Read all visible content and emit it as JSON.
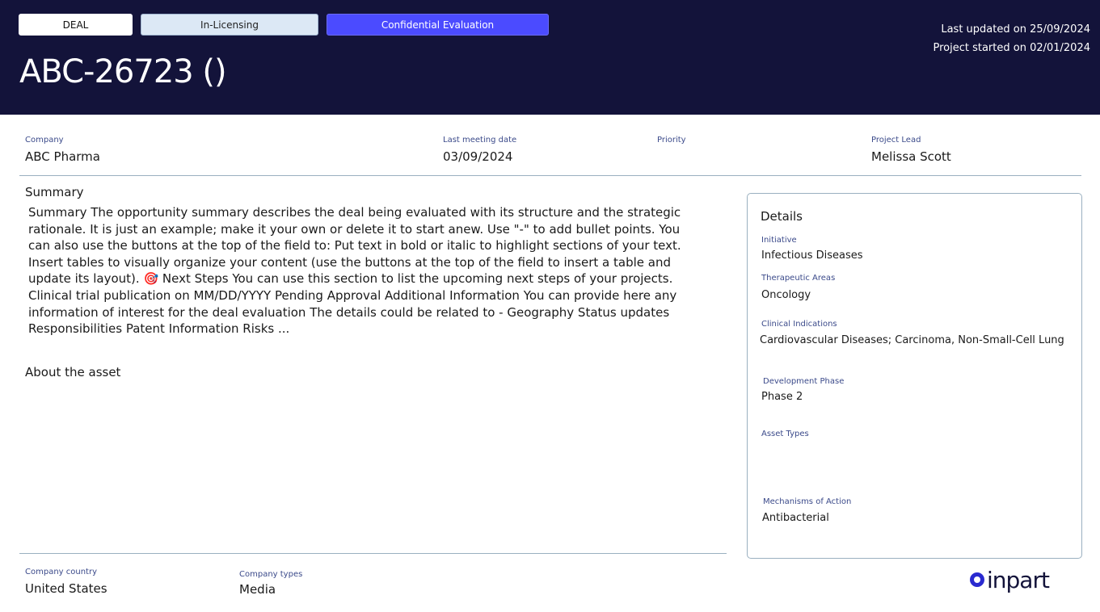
{
  "header": {
    "pill_deal": "DEAL",
    "pill_type": "In-Licensing",
    "pill_status": "Confidential Evaluation",
    "title": "ABC-26723 ()",
    "last_updated": "Last updated on 25/09/2024",
    "project_started": "Project started on 02/01/2024",
    "colors": {
      "background": "#13133a",
      "status_pill": "#4b4bff",
      "type_pill": "#dce8f5"
    }
  },
  "meta": {
    "company_label": "Company",
    "company_value": "ABC Pharma",
    "meeting_label": "Last meeting date",
    "meeting_value": "03/09/2024",
    "priority_label": "Priority",
    "priority_value": "",
    "lead_label": "Project Lead",
    "lead_value": "Melissa Scott"
  },
  "summary": {
    "title": "Summary",
    "body": "Summary The opportunity summary describes the deal being evaluated with its structure and the strategic rationale. It is just an example; make it your own or delete it to start anew. Use \"-\" to add bullet points. You can also use the buttons at the top of the field to: Put text in bold or italic to highlight sections of your text. Insert tables to visually organize your content (use the buttons at the top of the field to insert a table and update its layout). 🎯 Next Steps You can use this section to list the upcoming next steps of your projects. Clinical trial publication on MM/DD/YYYY Pending Approval Additional Information You can provide here any information of interest for the deal evaluation The details could be related to - Geography Status updates Responsibilities Patent Information Risks ..."
  },
  "about": {
    "title": "About the asset"
  },
  "details": {
    "title": "Details",
    "initiative_label": "Initiative",
    "initiative_value": "Infectious Diseases",
    "therapeutic_label": "Therapeutic Areas",
    "therapeutic_value": "Oncology",
    "indications_label": "Clinical Indications",
    "indications_value": "Cardiovascular Diseases; Carcinoma, Non-Small-Cell Lung",
    "phase_label": "Development Phase",
    "phase_value": "Phase 2",
    "asset_types_label": "Asset Types",
    "asset_types_value": "",
    "moa_label": "Mechanisms of Action",
    "moa_value": "Antibacterial"
  },
  "footer": {
    "country_label": "Company country",
    "country_value": "United States",
    "types_label": "Company types",
    "types_value": "Media",
    "logo_text": "inpart",
    "logo_icon": "inpart-logo-icon"
  }
}
